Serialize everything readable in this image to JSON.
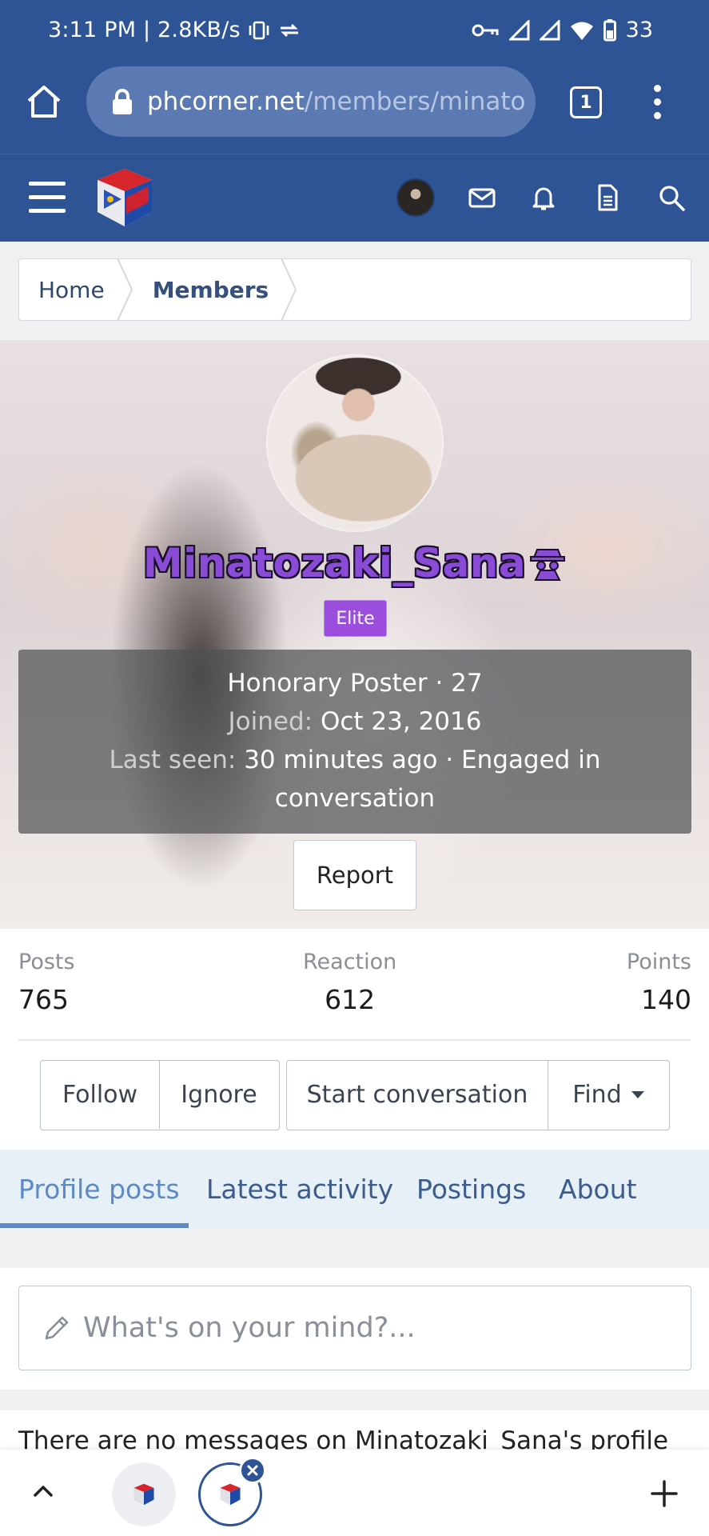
{
  "status_bar": {
    "left_text": "3:11 PM | 2.8KB/s",
    "battery": "33",
    "icons": [
      "vibrate-icon",
      "data-saver-icon",
      "vpn-key-icon",
      "signal-icon",
      "signal-icon",
      "wifi-icon",
      "battery-icon"
    ]
  },
  "browser": {
    "url_host": "phcorner.net",
    "url_path": "/members/minato",
    "tab_count": "1"
  },
  "breadcrumb": {
    "items": [
      "Home",
      "Members"
    ]
  },
  "profile": {
    "username": "Minatozaki_Sana",
    "badge": "Elite",
    "title_line": "Honorary Poster · 27",
    "joined_label": "Joined:",
    "joined_value": "Oct 23, 2016",
    "last_seen_label": "Last seen:",
    "last_seen_value": "30 minutes ago · Engaged in",
    "last_seen_value_2": "conversation",
    "report_label": "Report"
  },
  "stats": {
    "posts_label": "Posts",
    "posts_value": "765",
    "reaction_label": "Reaction",
    "reaction_value": "612",
    "points_label": "Points",
    "points_value": "140"
  },
  "actions": {
    "follow": "Follow",
    "ignore": "Ignore",
    "start_conversation": "Start conversation",
    "find": "Find"
  },
  "tabs": {
    "profile_posts": "Profile posts",
    "latest_activity": "Latest activity",
    "postings": "Postings",
    "about": "About"
  },
  "composer": {
    "placeholder": "What's on your mind?..."
  },
  "empty_state": {
    "text": "There are no messages on Minatozaki_Sana's profile"
  },
  "colors": {
    "header_blue": "#2f5496",
    "username_purple": "#8a4bd6",
    "badge_purple": "#9b4dde",
    "tab_active": "#5b8ac7"
  }
}
